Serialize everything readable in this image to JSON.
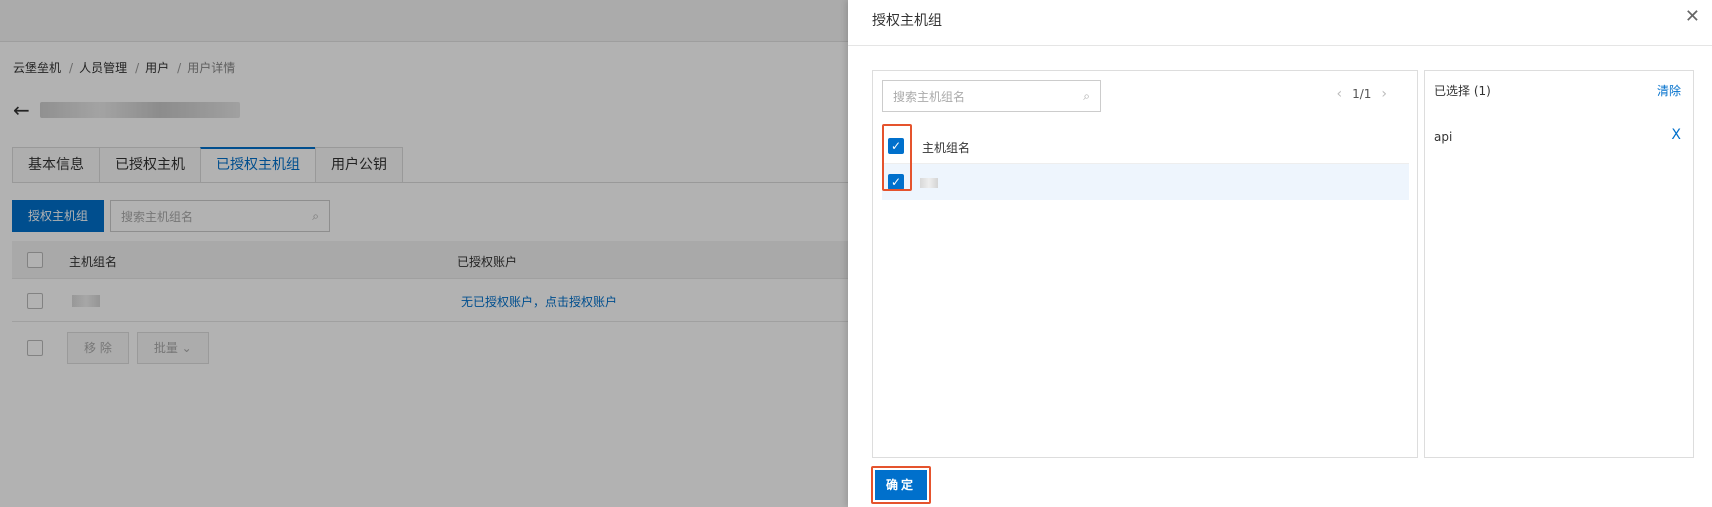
{
  "breadcrumb": [
    "云堡垒机",
    "人员管理",
    "用户",
    "用户详情"
  ],
  "breadcrumb_sep": "/",
  "tabs": [
    "基本信息",
    "已授权主机",
    "已授权主机组",
    "用户公钥"
  ],
  "toolbar": {
    "authorize_button": "授权主机组",
    "search_placeholder": "搜索主机组名"
  },
  "table": {
    "headers": [
      "主机组名",
      "已授权账户"
    ],
    "rows": [
      {
        "auth_account_link": "无已授权账户，点击授权账户"
      }
    ]
  },
  "footer": {
    "remove": "移 除",
    "batch": "批量"
  },
  "drawer": {
    "title": "授权主机组",
    "search_placeholder": "搜索主机组名",
    "pager": "1/1",
    "list_header": "主机组名",
    "selected_label": "已选择 (1)",
    "clear": "清除",
    "selected_items": [
      "api"
    ],
    "remove_icon": "X",
    "confirm": "确定"
  },
  "colors": {
    "primary": "#0070cc",
    "highlight": "#e5532d"
  }
}
